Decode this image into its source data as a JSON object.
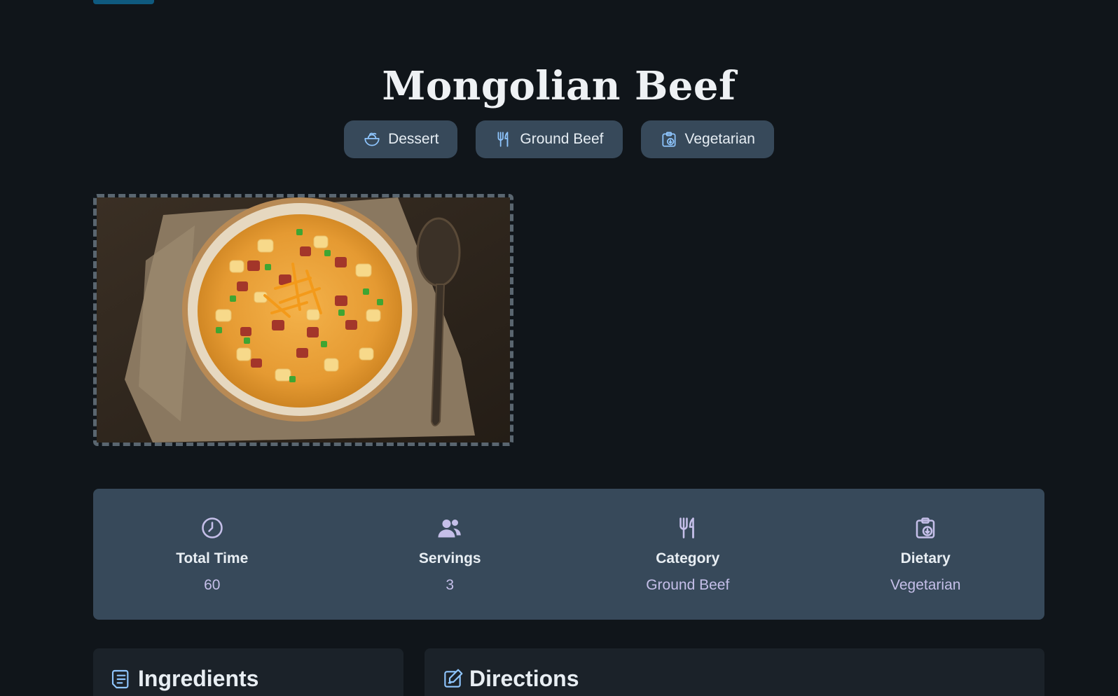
{
  "recipe": {
    "title": "Mongolian Beef",
    "tags": [
      {
        "icon": "bowl-icon",
        "label": "Dessert"
      },
      {
        "icon": "utensils-icon",
        "label": "Ground Beef"
      },
      {
        "icon": "clipboard-download-icon",
        "label": "Vegetarian"
      }
    ],
    "stats": [
      {
        "icon": "clock-icon",
        "label": "Total Time",
        "value": "60"
      },
      {
        "icon": "people-icon",
        "label": "Servings",
        "value": "3"
      },
      {
        "icon": "utensils-icon",
        "label": "Category",
        "value": "Ground Beef"
      },
      {
        "icon": "clipboard-download-icon",
        "label": "Dietary",
        "value": "Vegetarian"
      }
    ],
    "sections": {
      "ingredients": {
        "icon": "list-icon",
        "label": "Ingredients"
      },
      "directions": {
        "icon": "edit-icon",
        "label": "Directions"
      }
    }
  },
  "colors": {
    "background": "#10151a",
    "chip_bg": "#37495a",
    "chip_icon": "#8fc6ff",
    "stat_icon": "#c5bfe9",
    "panel_bg": "#1b2229"
  }
}
